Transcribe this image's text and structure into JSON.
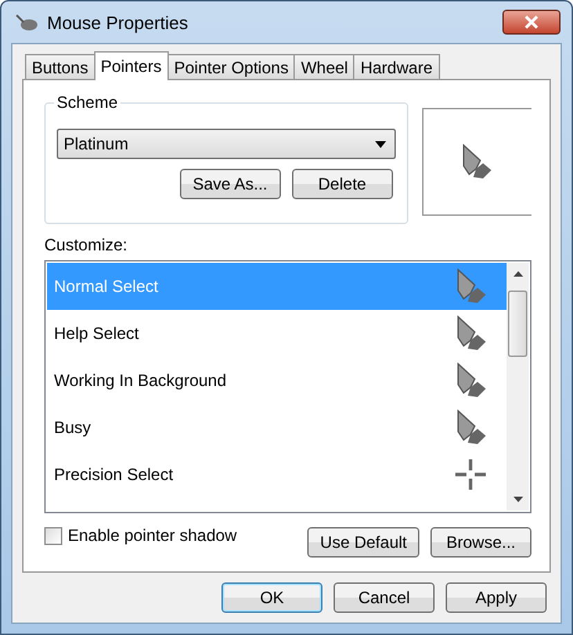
{
  "window": {
    "title": "Mouse Properties"
  },
  "tabs": [
    {
      "label": "Buttons",
      "selected": false
    },
    {
      "label": "Pointers",
      "selected": true
    },
    {
      "label": "Pointer Options",
      "selected": false
    },
    {
      "label": "Wheel",
      "selected": false
    },
    {
      "label": "Hardware",
      "selected": false
    }
  ],
  "scheme": {
    "label": "Scheme",
    "value": "Platinum",
    "buttons": [
      "Save As...",
      "Delete"
    ]
  },
  "customize": {
    "label": "Customize:",
    "items": [
      {
        "name": "Normal Select",
        "kind": "arrow",
        "selected": true
      },
      {
        "name": "Help Select",
        "kind": "arrow",
        "selected": false
      },
      {
        "name": "Working In Background",
        "kind": "arrow",
        "selected": false
      },
      {
        "name": "Busy",
        "kind": "arrow",
        "selected": false
      },
      {
        "name": "Precision Select",
        "kind": "crosshair",
        "selected": false
      }
    ]
  },
  "shadow": {
    "label": "Enable pointer shadow",
    "checked": false
  },
  "list_buttons": [
    "Use Default",
    "Browse..."
  ],
  "buttons": [
    "OK",
    "Cancel",
    "Apply"
  ]
}
